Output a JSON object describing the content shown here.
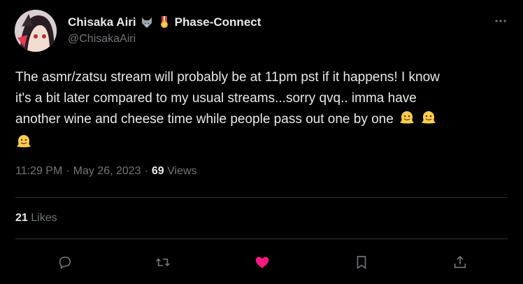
{
  "author": {
    "name": "Chisaka Airi",
    "affiliation": "Phase-Connect",
    "handle": "@ChisakaAiri"
  },
  "icons": {
    "wolf_badge": "wolf-emoji-icon",
    "medal_badge": "military-medal-icon",
    "more": "more-horizontal-icon",
    "melting_face": "melting-face-emoji-icon"
  },
  "tweet": {
    "line1": "The asmr/zatsu stream will probably be at 11pm pst if it happens! I know",
    "line2": "it's a bit later compared to my usual streams...sorry qvq.. imma have",
    "line3": "another wine and cheese time while people pass out one by one"
  },
  "meta": {
    "time": "11:29 PM",
    "date": "May 26, 2023",
    "separator": "·",
    "views_count": "69",
    "views_label": "Views"
  },
  "stats": {
    "likes_count": "21",
    "likes_label": "Likes"
  },
  "actions": [
    "reply-icon",
    "retweet-icon",
    "like-icon",
    "bookmark-icon",
    "share-icon"
  ],
  "colors": {
    "background": "#000000",
    "text": "#e7e9ea",
    "muted": "#71767b",
    "divider": "#2f3336",
    "like_active": "#f91880"
  }
}
